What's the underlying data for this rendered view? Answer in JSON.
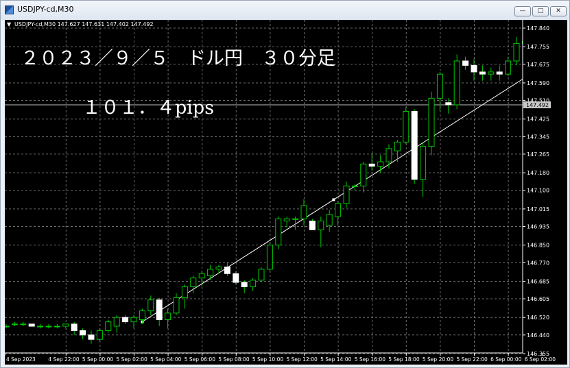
{
  "window": {
    "title": "USDJPY-cd,M30",
    "minimize_glyph": "—",
    "maximize_glyph": "□",
    "close_glyph": "✕"
  },
  "chart": {
    "info_arrow": "▼",
    "info": "USDJPY-cd,M30  147.627 147.631 147.402 147.492",
    "annotation_title": "２０２３／９／５　ドル円　３０分足",
    "annotation_pips": "１０１．４pips",
    "current_price": "147.492"
  },
  "colors": {
    "background": "#000000",
    "grid": "#6e6e6e",
    "up_candle": "#00c800",
    "down_candle_body": "#ffffff",
    "text": "#ffffff",
    "price_tag_bg": "#c8c8c8",
    "trendline": "#ffffff"
  },
  "chart_data": {
    "type": "candlestick",
    "symbol": "USDJPY",
    "timeframe": "M30",
    "grid": true,
    "ylim": [
      146.36,
      147.86
    ],
    "y_ticks": [
      "147.840",
      "147.755",
      "147.675",
      "147.590",
      "147.510",
      "147.425",
      "147.345",
      "147.265",
      "147.180",
      "147.100",
      "147.015",
      "146.935",
      "146.850",
      "146.770",
      "146.685",
      "146.605",
      "146.520",
      "146.440",
      "146.355"
    ],
    "x_ticks": [
      "4 Sep 2023",
      "4 Sep 22:00",
      "5 Sep 00:00",
      "5 Sep 02:00",
      "5 Sep 04:00",
      "5 Sep 06:00",
      "5 Sep 08:00",
      "5 Sep 10:00",
      "5 Sep 12:00",
      "5 Sep 14:00",
      "5 Sep 16:00",
      "5 Sep 18:00",
      "5 Sep 20:00",
      "5 Sep 22:00",
      "6 Sep 00:00",
      "6 Sep 02:00"
    ],
    "first_time": "4 Sep 2023 18:00",
    "bar_minutes": 30,
    "candles": [
      [
        146.48,
        146.49,
        146.47,
        146.48
      ],
      [
        146.49,
        146.5,
        146.48,
        146.49
      ],
      [
        146.49,
        146.5,
        146.48,
        146.49
      ],
      [
        146.49,
        146.49,
        146.48,
        146.48
      ],
      [
        146.48,
        146.49,
        146.47,
        146.48
      ],
      [
        146.48,
        146.49,
        146.47,
        146.48
      ],
      [
        146.48,
        146.49,
        146.47,
        146.48
      ],
      [
        146.48,
        146.49,
        146.47,
        146.49
      ],
      [
        146.49,
        146.5,
        146.44,
        146.46
      ],
      [
        146.46,
        146.47,
        146.42,
        146.44
      ],
      [
        146.44,
        146.46,
        146.4,
        146.42
      ],
      [
        146.42,
        146.47,
        146.41,
        146.46
      ],
      [
        146.46,
        146.51,
        146.45,
        146.5
      ],
      [
        146.48,
        146.53,
        146.45,
        146.52
      ],
      [
        146.52,
        146.53,
        146.49,
        146.5
      ],
      [
        146.5,
        146.53,
        146.47,
        146.52
      ],
      [
        146.51,
        146.56,
        146.49,
        146.55
      ],
      [
        146.55,
        146.62,
        146.53,
        146.6
      ],
      [
        146.6,
        146.61,
        146.48,
        146.51
      ],
      [
        146.51,
        146.56,
        146.47,
        146.54
      ],
      [
        146.54,
        146.63,
        146.53,
        146.61
      ],
      [
        146.61,
        146.67,
        146.56,
        146.66
      ],
      [
        146.66,
        146.71,
        146.63,
        146.7
      ],
      [
        146.7,
        146.73,
        146.66,
        146.72
      ],
      [
        146.71,
        146.76,
        146.69,
        146.74
      ],
      [
        146.74,
        146.76,
        146.72,
        146.75
      ],
      [
        146.75,
        146.77,
        146.71,
        146.72
      ],
      [
        146.72,
        146.73,
        146.67,
        146.68
      ],
      [
        146.68,
        146.69,
        146.63,
        146.66
      ],
      [
        146.66,
        146.7,
        146.64,
        146.69
      ],
      [
        146.69,
        146.75,
        146.68,
        146.74
      ],
      [
        146.74,
        146.86,
        146.73,
        146.85
      ],
      [
        146.85,
        146.98,
        146.83,
        146.97
      ],
      [
        146.96,
        146.98,
        146.93,
        146.97
      ],
      [
        146.97,
        146.98,
        146.92,
        146.97
      ],
      [
        146.97,
        147.06,
        146.94,
        147.03
      ],
      [
        146.96,
        146.97,
        146.92,
        146.92
      ],
      [
        146.92,
        146.98,
        146.84,
        146.96
      ],
      [
        146.94,
        147.01,
        146.91,
        146.99
      ],
      [
        146.98,
        147.05,
        146.94,
        147.04
      ],
      [
        147.04,
        147.14,
        147.02,
        147.12
      ],
      [
        147.12,
        147.13,
        147.1,
        147.12
      ],
      [
        147.12,
        147.23,
        147.09,
        147.22
      ],
      [
        147.22,
        147.27,
        147.19,
        147.21
      ],
      [
        147.21,
        147.26,
        147.18,
        147.23
      ],
      [
        147.23,
        147.31,
        147.2,
        147.29
      ],
      [
        147.28,
        147.33,
        147.23,
        147.32
      ],
      [
        147.32,
        147.48,
        147.31,
        147.46
      ],
      [
        147.46,
        147.47,
        147.13,
        147.15
      ],
      [
        147.15,
        147.32,
        147.07,
        147.3
      ],
      [
        147.3,
        147.55,
        147.26,
        147.52
      ],
      [
        147.52,
        147.64,
        147.46,
        147.63
      ],
      [
        147.5,
        147.52,
        147.45,
        147.49
      ],
      [
        147.49,
        147.72,
        147.47,
        147.69
      ],
      [
        147.69,
        147.71,
        147.65,
        147.67
      ],
      [
        147.67,
        147.7,
        147.6,
        147.64
      ],
      [
        147.64,
        147.67,
        147.6,
        147.63
      ],
      [
        147.63,
        147.66,
        147.6,
        147.64
      ],
      [
        147.64,
        147.67,
        147.6,
        147.63
      ],
      [
        147.63,
        147.71,
        147.62,
        147.69
      ],
      [
        147.69,
        147.8,
        147.67,
        147.77
      ],
      [
        147.77,
        147.81,
        147.72,
        147.78
      ],
      [
        147.78,
        147.79,
        147.75,
        147.76
      ],
      [
        147.76,
        147.78,
        147.73,
        147.74
      ],
      [
        147.74,
        147.77,
        147.68,
        147.7
      ],
      [
        147.7,
        147.73,
        147.69,
        147.72
      ],
      [
        147.72,
        147.73,
        147.7,
        147.72
      ],
      [
        147.72,
        147.73,
        147.69,
        147.7
      ],
      [
        147.7,
        147.71,
        147.68,
        147.69
      ],
      [
        147.69,
        147.71,
        147.63,
        147.65
      ],
      [
        147.65,
        147.7,
        147.64,
        147.68
      ],
      [
        147.68,
        147.69,
        147.6,
        147.62
      ],
      [
        147.62,
        147.64,
        147.56,
        147.6
      ],
      [
        147.63,
        147.63,
        147.4,
        147.49
      ]
    ],
    "trendline": {
      "from": [
        "5 Sep 02:00",
        146.5
      ],
      "to": [
        "6 Sep 00:30",
        147.614
      ]
    }
  }
}
